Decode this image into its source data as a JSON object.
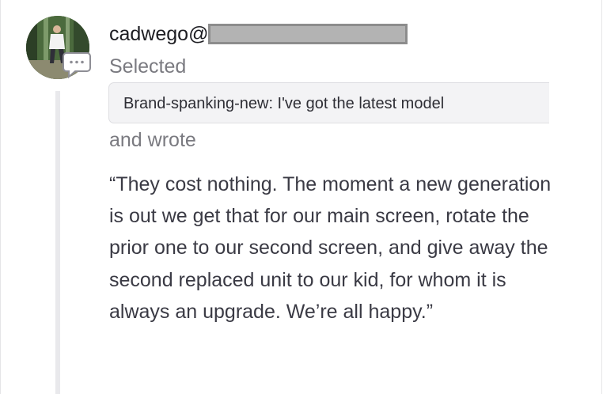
{
  "author": {
    "name_visible": "cadwego@"
  },
  "action": {
    "selected_label": "Selected",
    "wrote_label": "and wrote"
  },
  "selection": {
    "text": "Brand-spanking-new: I've got the latest model"
  },
  "comment": {
    "text": "“They cost nothing. The moment a new generation is out we get that for our main screen, rotate the prior one to our second screen, and give away the second replaced unit to our kid, for whom it is always an upgrade. We’re all happy.”"
  },
  "icons": {
    "badge": "comment-bubble-icon"
  },
  "colors": {
    "text_primary": "#1d1d22",
    "text_secondary": "#7a7a80",
    "chip_background": "#f3f3f5",
    "redaction": "#b3b3b3"
  }
}
